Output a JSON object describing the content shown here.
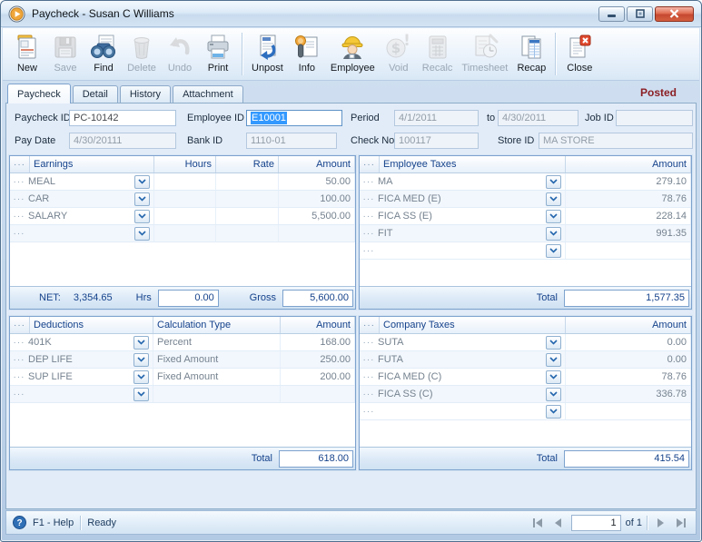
{
  "window": {
    "title": "Paycheck - Susan C Williams"
  },
  "colors": {
    "posted": "#8b1f24",
    "selection": "#3399ff",
    "grid_header_text": "#15428b"
  },
  "toolbar": {
    "buttons": [
      {
        "label": "New",
        "icon": "new-document-icon",
        "enabled": true,
        "group": 1
      },
      {
        "label": "Save",
        "icon": "save-floppy-icon",
        "enabled": false,
        "group": 1
      },
      {
        "label": "Find",
        "icon": "find-binoculars-icon",
        "enabled": true,
        "group": 1
      },
      {
        "label": "Delete",
        "icon": "delete-trash-icon",
        "enabled": false,
        "group": 1
      },
      {
        "label": "Undo",
        "icon": "undo-arrow-icon",
        "enabled": false,
        "group": 1
      },
      {
        "label": "Print",
        "icon": "printer-icon",
        "enabled": true,
        "group": 1
      },
      {
        "label": "Unpost",
        "icon": "unpost-arrow-icon",
        "enabled": true,
        "group": 2
      },
      {
        "label": "Info",
        "icon": "info-card-icon",
        "enabled": true,
        "group": 2
      },
      {
        "label": "Employee",
        "icon": "employee-person-icon",
        "enabled": true,
        "group": 2
      },
      {
        "label": "Void",
        "icon": "void-dollar-icon",
        "enabled": false,
        "group": 2
      },
      {
        "label": "Recalc",
        "icon": "recalc-calculator-icon",
        "enabled": false,
        "group": 2
      },
      {
        "label": "Timesheet",
        "icon": "timesheet-clock-icon",
        "enabled": false,
        "group": 2
      },
      {
        "label": "Recap",
        "icon": "recap-sheet-icon",
        "enabled": true,
        "group": 2
      },
      {
        "label": "Close",
        "icon": "close-document-icon",
        "enabled": true,
        "group": 3
      }
    ]
  },
  "tabs": [
    {
      "label": "Paycheck",
      "active": true
    },
    {
      "label": "Detail",
      "active": false
    },
    {
      "label": "History",
      "active": false
    },
    {
      "label": "Attachment",
      "active": false
    }
  ],
  "posted_badge": "Posted",
  "fields": {
    "paycheck_id": {
      "label": "Paycheck ID",
      "value": "PC-10142"
    },
    "employee_id": {
      "label": "Employee ID",
      "value": "E10001",
      "selected": true
    },
    "period": {
      "label": "Period",
      "value": "4/1/2011"
    },
    "period_to": {
      "label": "to",
      "value": "4/30/2011"
    },
    "job_id": {
      "label": "Job ID",
      "value": ""
    },
    "pay_date": {
      "label": "Pay Date",
      "value": "4/30/20111"
    },
    "bank_id": {
      "label": "Bank ID",
      "value": "1110-01"
    },
    "check_no": {
      "label": "Check No",
      "value": "100117"
    },
    "store_id": {
      "label": "Store ID",
      "value": "MA STORE"
    }
  },
  "grids": {
    "earnings": {
      "headers": {
        "name": "Earnings",
        "hours": "Hours",
        "rate": "Rate",
        "amount": "Amount"
      },
      "rows": [
        {
          "name": "MEAL",
          "hours": "",
          "rate": "",
          "amount": "50.00"
        },
        {
          "name": "CAR",
          "hours": "",
          "rate": "",
          "amount": "100.00"
        },
        {
          "name": "SALARY",
          "hours": "",
          "rate": "",
          "amount": "5,500.00"
        },
        {
          "name": "",
          "hours": "",
          "rate": "",
          "amount": ""
        }
      ],
      "footer": {
        "net_label": "NET:",
        "net_value": "3,354.65",
        "hrs_label": "Hrs",
        "hrs_value": "0.00",
        "gross_label": "Gross",
        "gross_value": "5,600.00"
      }
    },
    "employee_taxes": {
      "headers": {
        "name": "Employee Taxes",
        "amount": "Amount"
      },
      "rows": [
        {
          "name": "MA",
          "amount": "279.10"
        },
        {
          "name": "FICA MED (E)",
          "amount": "78.76"
        },
        {
          "name": "FICA SS (E)",
          "amount": "228.14"
        },
        {
          "name": "FIT",
          "amount": "991.35"
        },
        {
          "name": "",
          "amount": ""
        }
      ],
      "footer": {
        "total_label": "Total",
        "total_value": "1,577.35"
      }
    },
    "deductions": {
      "headers": {
        "name": "Deductions",
        "calctype": "Calculation Type",
        "amount": "Amount"
      },
      "rows": [
        {
          "name": "401K",
          "calctype": "Percent",
          "amount": "168.00"
        },
        {
          "name": "DEP LIFE",
          "calctype": "Fixed Amount",
          "amount": "250.00"
        },
        {
          "name": "SUP LIFE",
          "calctype": "Fixed Amount",
          "amount": "200.00"
        },
        {
          "name": "",
          "calctype": "",
          "amount": ""
        }
      ],
      "footer": {
        "total_label": "Total",
        "total_value": "618.00"
      }
    },
    "company_taxes": {
      "headers": {
        "name": "Company Taxes",
        "amount": "Amount"
      },
      "rows": [
        {
          "name": "SUTA",
          "amount": "0.00"
        },
        {
          "name": "FUTA",
          "amount": "0.00"
        },
        {
          "name": "FICA MED (C)",
          "amount": "78.76"
        },
        {
          "name": "FICA SS (C)",
          "amount": "336.78"
        },
        {
          "name": "",
          "amount": ""
        }
      ],
      "footer": {
        "total_label": "Total",
        "total_value": "415.54"
      }
    }
  },
  "statusbar": {
    "help": "F1 - Help",
    "status": "Ready",
    "page": "1",
    "of": "of 1"
  }
}
